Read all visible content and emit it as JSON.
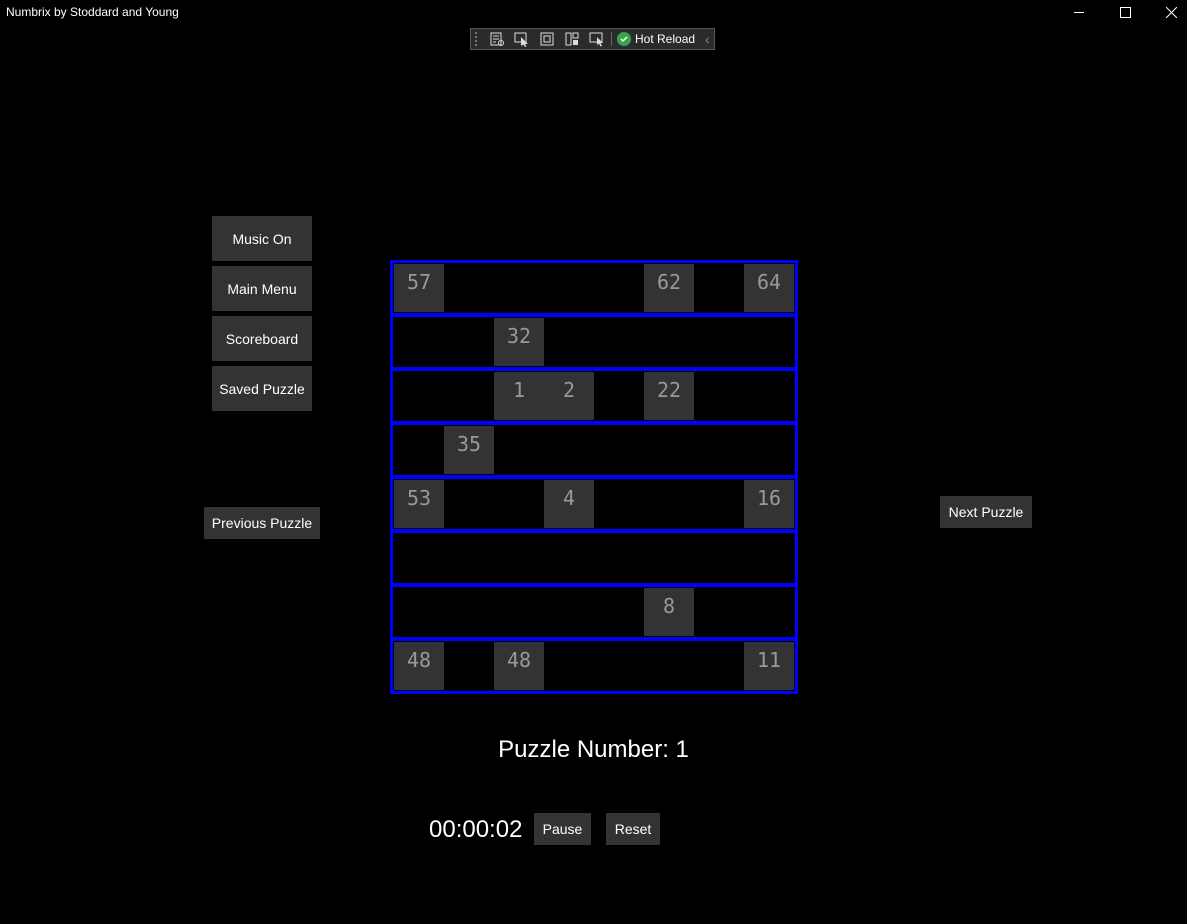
{
  "window": {
    "title": "Numbrix by Stoddard and Young",
    "minimize_icon": "minimize-icon",
    "maximize_icon": "maximize-icon",
    "close_icon": "close-icon"
  },
  "hot_reload_toolbar": {
    "label": "Hot Reload",
    "tools": [
      "live-visual-tree-icon",
      "select-element-icon",
      "display-layout-adorners-icon",
      "track-focus-icon",
      "preview-selection-icon"
    ]
  },
  "menu": {
    "music": "Music On",
    "main_menu": "Main Menu",
    "scoreboard": "Scoreboard",
    "saved_puzzle": "Saved Puzzle"
  },
  "navigation": {
    "previous": "Previous Puzzle",
    "next": "Next Puzzle"
  },
  "grid": {
    "rows": [
      [
        "57",
        "",
        "",
        "",
        "",
        "62",
        "",
        "64"
      ],
      [
        "",
        "",
        "32",
        "",
        "",
        "",
        "",
        ""
      ],
      [
        "",
        "",
        "1",
        "2",
        "",
        "22",
        "",
        ""
      ],
      [
        "",
        "35",
        "",
        "",
        "",
        "",
        "",
        ""
      ],
      [
        "53",
        "",
        "",
        "4",
        "",
        "",
        "",
        "16"
      ],
      [
        "",
        "",
        "",
        "",
        "",
        "",
        "",
        ""
      ],
      [
        "",
        "",
        "",
        "",
        "",
        "8",
        "",
        ""
      ],
      [
        "48",
        "",
        "48",
        "",
        "",
        "",
        "",
        "11"
      ]
    ]
  },
  "puzzle_number": "Puzzle Number: 1",
  "timer": {
    "value": "00:00:02",
    "pause": "Pause",
    "reset": "Reset"
  },
  "colors": {
    "background": "#000000",
    "button_bg": "#333333",
    "grid_border": "#0000ff",
    "cell_text": "#999999"
  }
}
